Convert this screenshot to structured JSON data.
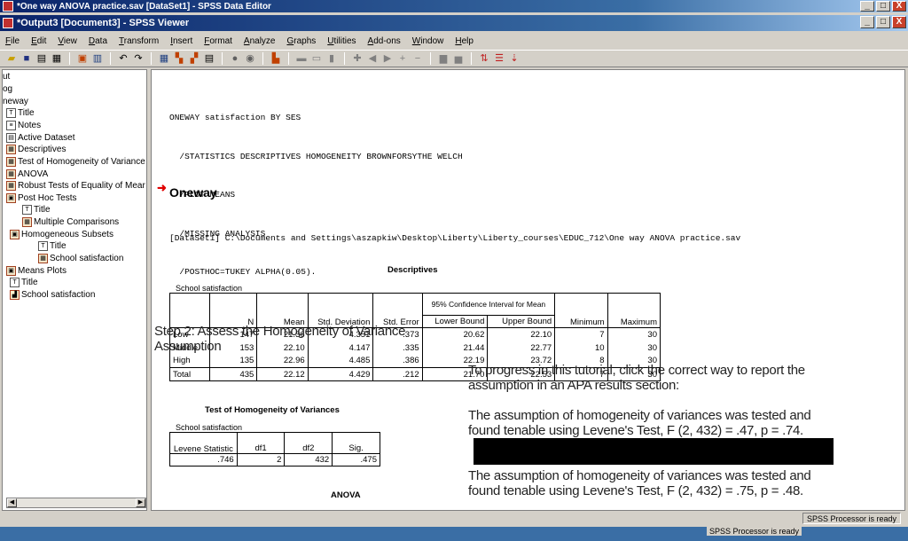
{
  "outer_window": {
    "title": "*One way ANOVA practice.sav [DataSet1] - SPSS Data Editor"
  },
  "viewer_window": {
    "title": "*Output3 [Document3] - SPSS Viewer"
  },
  "window_buttons": {
    "minimize": "_",
    "maximize": "□",
    "close": "X"
  },
  "menu": [
    "File",
    "Edit",
    "View",
    "Data",
    "Transform",
    "Insert",
    "Format",
    "Analyze",
    "Graphs",
    "Utilities",
    "Add-ons",
    "Window",
    "Help"
  ],
  "outline": [
    {
      "label": "ut",
      "icon": "none"
    },
    {
      "label": "og",
      "icon": "none"
    },
    {
      "label": "neway",
      "icon": "none"
    },
    {
      "label": "Title",
      "icon": "title-icon"
    },
    {
      "label": "Notes",
      "icon": "notes-icon"
    },
    {
      "label": "Active Dataset",
      "icon": "dataset-icon"
    },
    {
      "label": "Descriptives",
      "icon": "table-icon"
    },
    {
      "label": "Test of Homogeneity of Variance",
      "icon": "table-icon"
    },
    {
      "label": "ANOVA",
      "icon": "table-icon"
    },
    {
      "label": "Robust Tests of Equality of Mear",
      "icon": "table-icon"
    },
    {
      "label": "Post Hoc Tests",
      "icon": "book-icon"
    },
    {
      "label": "Title",
      "icon": "title-icon"
    },
    {
      "label": "Multiple Comparisons",
      "icon": "table-icon"
    },
    {
      "label": "Homogeneous Subsets",
      "icon": "book-icon"
    },
    {
      "label": "Title",
      "icon": "title-icon"
    },
    {
      "label": "School satisfaction",
      "icon": "table-icon"
    },
    {
      "label": "Means Plots",
      "icon": "book-icon"
    },
    {
      "label": "Title",
      "icon": "title-icon"
    },
    {
      "label": "School satisfaction",
      "icon": "chart-icon"
    }
  ],
  "syntax": {
    "lines": [
      "ONEWAY satisfaction BY SES",
      "  /STATISTICS DESCRIPTIVES HOMOGENEITY BROWNFORSYTHE WELCH",
      "  /PLOT MEANS",
      "  /MISSING ANALYSIS",
      "  /POSTHOC=TUKEY ALPHA(0.05)."
    ]
  },
  "oneway_heading": "Oneway",
  "dataset_path": "[DataSet1] C:\\Documents and Settings\\aszapkiw\\Desktop\\Liberty\\Liberty_courses\\EDUC_712\\One way ANOVA practice.sav",
  "descriptives": {
    "title": "Descriptives",
    "subtitle": "School satisfaction",
    "ci_header": "95% Confidence Interval for Mean",
    "columns": [
      "N",
      "Mean",
      "Std. Deviation",
      "Std. Error",
      "Lower Bound",
      "Upper Bound",
      "Minimum",
      "Maximum"
    ],
    "rows": [
      {
        "label": "Low",
        "values": [
          "147",
          "21.36",
          "4.351",
          ".373",
          "20.62",
          "22.10",
          "7",
          "30"
        ]
      },
      {
        "label": "Middle",
        "values": [
          "153",
          "22.10",
          "4.147",
          ".335",
          "21.44",
          "22.77",
          "10",
          "30"
        ]
      },
      {
        "label": "High",
        "values": [
          "135",
          "22.96",
          "4.485",
          ".386",
          "22.19",
          "23.72",
          "8",
          "30"
        ]
      },
      {
        "label": "Total",
        "values": [
          "435",
          "22.12",
          "4.429",
          ".212",
          "21.70",
          "22.53",
          "7",
          "30"
        ]
      }
    ]
  },
  "homogeneity": {
    "title": "Test of Homogeneity of Variances",
    "subtitle": "School satisfaction",
    "columns": [
      "Levene Statistic",
      "df1",
      "df2",
      "Sig."
    ],
    "values": [
      ".746",
      "2",
      "432",
      ".475"
    ]
  },
  "anova": {
    "title": "ANOVA"
  },
  "overlay": {
    "step_title": "Step 2: Assess the Homogeneity of Variance Assumption",
    "prompt": "To progress in this tutorial, click the correct way to report the assumption in an APA results section:",
    "option1": "The assumption of homogeneity of variances was tested and found tenable using Levene's Test, F (2, 432) = .47, p = .74.",
    "option2": "The assumption of homogeneity of variances was tested and found tenable using Levene's Test, F (2, 432) = .75, p = .48."
  },
  "status": {
    "processor": "SPSS Processor is ready"
  }
}
